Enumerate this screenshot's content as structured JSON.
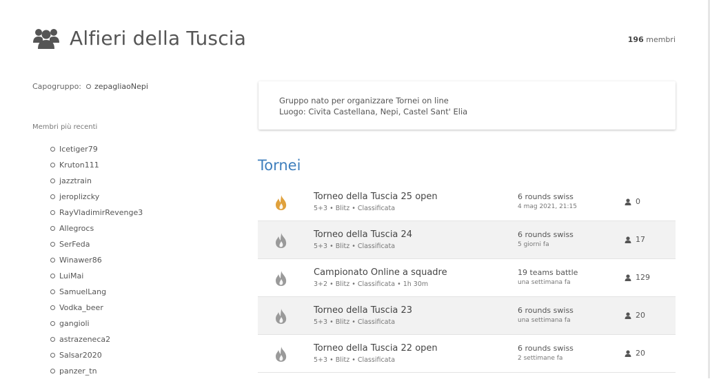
{
  "group": {
    "title": "Alfieri della Tuscia",
    "members_count": "196",
    "members_label": "membri"
  },
  "leader": {
    "label": "Capogruppo:",
    "name": "zepagliaoNepi"
  },
  "recent": {
    "title": "Membri più recenti",
    "members": [
      "Icetiger79",
      "Kruton111",
      "jazztrain",
      "jeroplizcky",
      "RayVladimirRevenge3",
      "Allegrocs",
      "SerFeda",
      "Winawer86",
      "LuiMai",
      "SamuelLang",
      "Vodka_beer",
      "gangioli",
      "astrazeneca2",
      "Salsar2020",
      "panzer_tn"
    ]
  },
  "description": {
    "line1": "Gruppo nato per organizzare Tornei on line",
    "line2": "Luogo: Civita Castellana, Nepi, Castel Sant' Elia"
  },
  "tournaments": {
    "title": "Tornei",
    "items": [
      {
        "name": "Torneo della Tuscia 25 open",
        "meta": "5+3 • Blitz • Classificata",
        "type": "6 rounds swiss",
        "date": "4 mag 2021, 21:15",
        "players": "0",
        "icon": "flame-icon",
        "active": true
      },
      {
        "name": "Torneo della Tuscia 24",
        "meta": "5+3 • Blitz • Classificata",
        "type": "6 rounds swiss",
        "date": "5 giorni fa",
        "players": "17",
        "icon": "flame-icon",
        "active": false
      },
      {
        "name": "Campionato Online a squadre",
        "meta": "3+2 • Blitz • Classificata • 1h 30m",
        "type": "19 teams battle",
        "date": "una settimana fa",
        "players": "129",
        "icon": "flame-icon",
        "active": false
      },
      {
        "name": "Torneo della Tuscia 23",
        "meta": "5+3 • Blitz • Classificata",
        "type": "6 rounds swiss",
        "date": "una settimana fa",
        "players": "20",
        "icon": "flame-icon",
        "active": false
      },
      {
        "name": "Torneo della Tuscia 22 open",
        "meta": "5+3 • Blitz • Classificata",
        "type": "6 rounds swiss",
        "date": "2 settimane fa",
        "players": "20",
        "icon": "flame-icon",
        "active": false
      }
    ]
  },
  "colors": {
    "accent": "#3f7fbd",
    "flame_active": "#e0a13c",
    "flame_inactive": "#9a9a9a"
  }
}
